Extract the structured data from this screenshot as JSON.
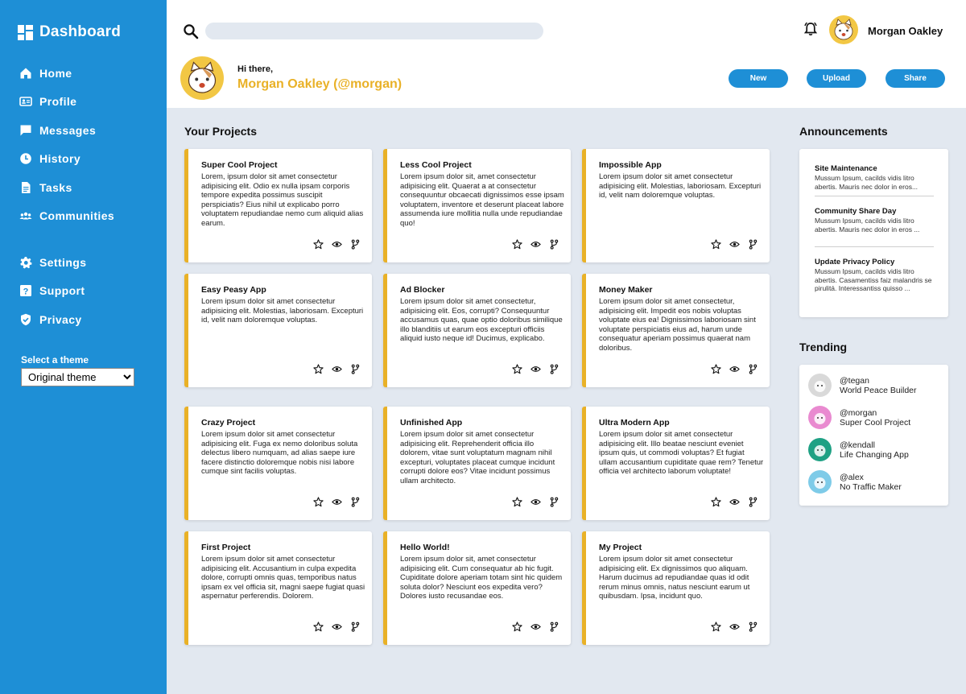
{
  "sidebar": {
    "brand": "Dashboard",
    "nav_main": [
      {
        "label": "Home",
        "icon": "home-icon"
      },
      {
        "label": "Profile",
        "icon": "profile-card-icon"
      },
      {
        "label": "Messages",
        "icon": "message-icon"
      },
      {
        "label": "History",
        "icon": "clock-icon"
      },
      {
        "label": "Tasks",
        "icon": "document-icon"
      },
      {
        "label": "Communities",
        "icon": "group-icon"
      }
    ],
    "nav_secondary": [
      {
        "label": "Settings",
        "icon": "gear-icon"
      },
      {
        "label": "Support",
        "icon": "help-icon"
      },
      {
        "label": "Privacy",
        "icon": "shield-icon"
      }
    ],
    "theme_label": "Select a theme",
    "theme_selected": "Original theme"
  },
  "header": {
    "search_placeholder": "",
    "user_name": "Morgan Oakley",
    "greeting": "Hi there,",
    "greeting_name": "Morgan Oakley (@morgan)",
    "buttons": {
      "new": "New",
      "upload": "Upload",
      "share": "Share"
    }
  },
  "projects": {
    "title": "Your Projects",
    "items": [
      {
        "title": "Super Cool Project",
        "desc": "Lorem, ipsum dolor sit amet consectetur adipisicing elit. Odio ex nulla ipsam corporis tempore expedita possimus suscipit perspiciatis? Eius nihil ut explicabo porro voluptatem repudiandae nemo cum aliquid alias earum."
      },
      {
        "title": "Less Cool Project",
        "desc": "Lorem ipsum dolor sit, amet consectetur adipisicing elit. Quaerat a at consectetur consequuntur obcaecati dignissimos esse ipsam voluptatem, inventore et deserunt placeat labore assumenda iure mollitia nulla unde repudiandae quo!"
      },
      {
        "title": "Impossible App",
        "desc": "Lorem ipsum dolor sit amet consectetur adipisicing elit. Molestias, laboriosam. Excepturi id, velit nam doloremque voluptas."
      },
      {
        "title": "Easy Peasy App",
        "desc": "Lorem ipsum dolor sit amet consectetur adipisicing elit. Molestias, laboriosam. Excepturi id, velit nam doloremque voluptas."
      },
      {
        "title": "Ad Blocker",
        "desc": "Lorem ipsum dolor sit amet consectetur, adipisicing elit. Eos, corrupti? Consequuntur accusamus quas, quae optio doloribus similique illo blanditiis ut earum eos excepturi officiis aliquid iusto neque id! Ducimus, explicabo."
      },
      {
        "title": "Money Maker",
        "desc": "Lorem ipsum dolor sit amet consectetur, adipisicing elit. Impedit eos nobis voluptas voluptate eius ea! Dignissimos laboriosam sint voluptate perspiciatis eius ad, harum unde consequatur aperiam possimus quaerat nam doloribus."
      },
      {
        "title": "Crazy Project",
        "desc": "Lorem ipsum dolor sit amet consectetur adipisicing elit. Fuga ex nemo doloribus soluta delectus libero numquam, ad alias saepe iure facere distinctio doloremque nobis nisi labore cumque sint facilis voluptas."
      },
      {
        "title": "Unfinished App",
        "desc": "Lorem ipsum dolor sit amet consectetur adipisicing elit. Reprehenderit officia illo dolorem, vitae sunt voluptatum magnam nihil excepturi, voluptates placeat cumque incidunt corrupti dolore eos? Vitae incidunt possimus ullam architecto."
      },
      {
        "title": "Ultra Modern App",
        "desc": "Lorem ipsum dolor sit amet consectetur adipisicing elit. Illo beatae nesciunt eveniet ipsum quis, ut commodi voluptas? Et fugiat ullam accusantium cupiditate quae rem? Tenetur officia vel architecto laborum voluptate!"
      },
      {
        "title": "First Project",
        "desc": "Lorem ipsum dolor sit amet consectetur adipisicing elit. Accusantium in culpa expedita dolore, corrupti omnis quas, temporibus natus ipsam ex vel officia sit, magni saepe fugiat quasi aspernatur perferendis. Dolorem."
      },
      {
        "title": "Hello World!",
        "desc": "Lorem ipsum dolor sit, amet consectetur adipisicing elit. Cum consequatur ab hic fugit. Cupiditate dolore aperiam totam sint hic quidem soluta dolor? Nesciunt eos expedita vero? Dolores iusto recusandae eos."
      },
      {
        "title": "My Project",
        "desc": "Lorem ipsum dolor sit amet consectetur adipisicing elit. Ex dignissimos quo aliquam. Harum ducimus ad repudiandae quas id odit rerum minus omnis, natus nesciunt earum ut quibusdam. Ipsa, incidunt quo."
      }
    ]
  },
  "announcements": {
    "title": "Announcements",
    "items": [
      {
        "title": "Site Maintenance",
        "body": "Mussum Ipsum, cacilds vidis litro abertis. Mauris nec dolor in eros..."
      },
      {
        "title": "Community Share Day",
        "body": "Mussum Ipsum, cacilds vidis litro abertis. Mauris nec dolor in eros ..."
      },
      {
        "title": "Update Privacy Policy",
        "body": "Mussum Ipsum, cacilds vidis litro abertis. Casamentiss faiz malandris se pirulitá. Interessantiss quisso ..."
      }
    ]
  },
  "trending": {
    "title": "Trending",
    "items": [
      {
        "handle": "@tegan",
        "project": "World Peace Builder",
        "color": "#d9d9d9"
      },
      {
        "handle": "@morgan",
        "project": "Super Cool Project",
        "color": "#e98ad0"
      },
      {
        "handle": "@kendall",
        "project": "Life Changing App",
        "color": "#1fa184"
      },
      {
        "handle": "@alex",
        "project": "No Traffic Maker",
        "color": "#7ecbe8"
      }
    ]
  },
  "colors": {
    "sidebar": "#1e8fd6",
    "accent": "#e9b127",
    "background": "#e2e8f0"
  }
}
